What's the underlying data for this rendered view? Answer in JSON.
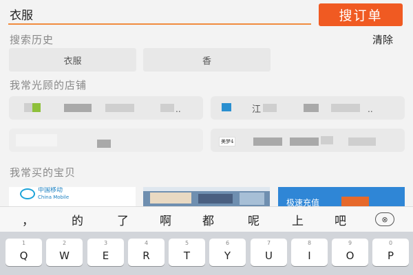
{
  "search": {
    "query": "衣服",
    "button_label": "搜订单"
  },
  "history": {
    "title": "搜索历史",
    "clear_label": "清除",
    "items": [
      "衣服",
      "香"
    ]
  },
  "stores": {
    "title": "我常光顾的店铺",
    "items": [
      {
        "text": "..",
        "logo": "green-square"
      },
      {
        "text": "江",
        "suffix": "..",
        "logo": "blue-square"
      },
      {
        "text": "",
        "logo": "none"
      },
      {
        "text": "",
        "logo": "brand-mark",
        "mark": "美梦4"
      }
    ]
  },
  "products": {
    "title": "我常买的宝贝",
    "items": [
      {
        "brand_cn": "中国移动",
        "brand_en": "China Mobile"
      },
      {
        "kind": "photo"
      },
      {
        "promo": "极速充值"
      }
    ]
  },
  "keyboard": {
    "candidates": [
      "，",
      "的",
      "了",
      "啊",
      "都",
      "呢",
      "上",
      "吧"
    ],
    "collapse_icon": "⊗",
    "keys": [
      {
        "num": "1",
        "letter": "Q"
      },
      {
        "num": "2",
        "letter": "W"
      },
      {
        "num": "3",
        "letter": "E"
      },
      {
        "num": "4",
        "letter": "R"
      },
      {
        "num": "5",
        "letter": "T"
      },
      {
        "num": "6",
        "letter": "Y"
      },
      {
        "num": "7",
        "letter": "U"
      },
      {
        "num": "8",
        "letter": "I"
      },
      {
        "num": "9",
        "letter": "O"
      },
      {
        "num": "0",
        "letter": "P"
      }
    ]
  },
  "colors": {
    "accent": "#f05a22",
    "underline": "#f08a3c",
    "background": "#f3f3f3"
  }
}
